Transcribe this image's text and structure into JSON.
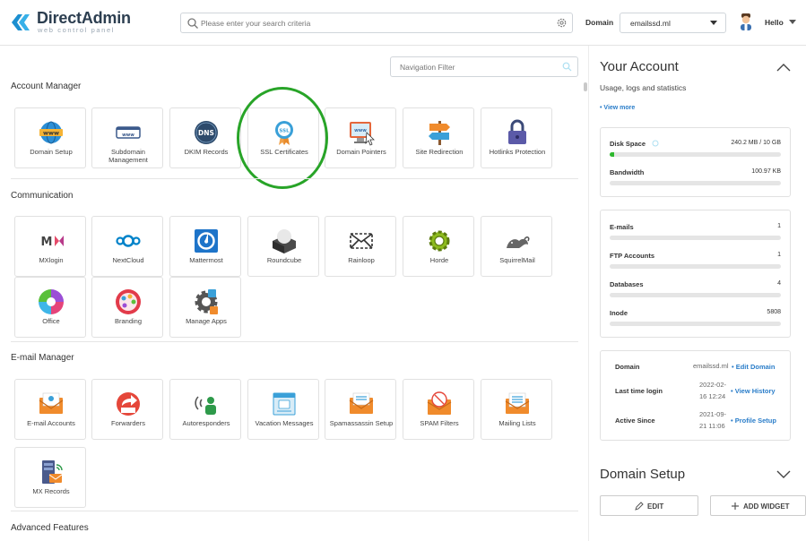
{
  "header": {
    "logo_title": "DirectAdmin",
    "logo_subtitle": "web control panel",
    "search_placeholder": "Please enter your search criteria",
    "domain_label": "Domain",
    "domain_value": "emailssd.ml",
    "user_label": "Hello"
  },
  "nav_filter_placeholder": "Navigation Filter",
  "sections": {
    "account_manager": {
      "title": "Account Manager",
      "tiles": [
        {
          "label": "Domain Setup",
          "icon": "www-globe-icon"
        },
        {
          "label": "Subdomain Management",
          "icon": "subdomain-icon"
        },
        {
          "label": "DKIM Records",
          "icon": "dns-globe-icon"
        },
        {
          "label": "SSL Certificates",
          "icon": "ssl-badge-icon"
        },
        {
          "label": "Domain Pointers",
          "icon": "domain-pointer-icon"
        },
        {
          "label": "Site Redirection",
          "icon": "signpost-icon"
        },
        {
          "label": "Hotlinks Protection",
          "icon": "padlock-icon"
        }
      ]
    },
    "communication": {
      "title": "Communication",
      "tiles": [
        {
          "label": "MXlogin",
          "icon": "mxlogin-icon"
        },
        {
          "label": "NextCloud",
          "icon": "nextcloud-icon"
        },
        {
          "label": "Mattermost",
          "icon": "mattermost-icon"
        },
        {
          "label": "Roundcube",
          "icon": "roundcube-icon"
        },
        {
          "label": "Rainloop",
          "icon": "rainloop-icon"
        },
        {
          "label": "Horde",
          "icon": "horde-icon"
        },
        {
          "label": "SquirrelMail",
          "icon": "squirrelmail-icon"
        },
        {
          "label": "Office",
          "icon": "office-icon"
        },
        {
          "label": "Branding",
          "icon": "branding-palette-icon"
        },
        {
          "label": "Manage Apps",
          "icon": "gear-apps-icon"
        }
      ]
    },
    "email_manager": {
      "title": "E-mail Manager",
      "tiles": [
        {
          "label": "E-mail Accounts",
          "icon": "email-accounts-icon"
        },
        {
          "label": "Forwarders",
          "icon": "forwarders-icon"
        },
        {
          "label": "Autoresponders",
          "icon": "autoresponder-icon"
        },
        {
          "label": "Vacation Messages",
          "icon": "vacation-messages-icon"
        },
        {
          "label": "Spamassassin Setup",
          "icon": "spamassassin-icon"
        },
        {
          "label": "SPAM Filters",
          "icon": "spam-filter-icon"
        },
        {
          "label": "Mailing Lists",
          "icon": "mailing-list-icon"
        },
        {
          "label": "MX Records",
          "icon": "mx-records-icon"
        }
      ]
    },
    "advanced_features": {
      "title": "Advanced Features"
    }
  },
  "your_account": {
    "title": "Your Account",
    "subtitle": "Usage, logs and statistics",
    "view_more": "• View more",
    "usage": [
      {
        "label": "Disk Space",
        "value": "240.2 MB / 10 GB",
        "fill": 0.024
      },
      {
        "label": "Bandwidth",
        "value": "100.97 KB",
        "fill": 0
      }
    ],
    "counts": [
      {
        "label": "E-mails",
        "value": "1",
        "fill": 0
      },
      {
        "label": "FTP Accounts",
        "value": "1",
        "fill": 0
      },
      {
        "label": "Databases",
        "value": "4",
        "fill": 0
      },
      {
        "label": "Inode",
        "value": "5808",
        "fill": 0
      }
    ],
    "info": {
      "domain_label": "Domain",
      "domain_value": "emailssd.ml",
      "domain_link": "• Edit Domain",
      "last_login_label": "Last time login",
      "last_login_value_1": "2022-02-",
      "last_login_value_2": "16 12:24",
      "last_login_link": "• View History",
      "active_since_label": "Active Since",
      "active_since_value_1": "2021-09-",
      "active_since_value_2": "21 11:06",
      "active_since_link": "• Profile Setup"
    }
  },
  "domain_setup": {
    "title": "Domain Setup",
    "edit_button": "EDIT",
    "add_widget_button": "ADD WIDGET"
  },
  "colors": {
    "accent": "#2a7dc9",
    "highlight": "#28a428",
    "progress": "#2eb82e"
  }
}
